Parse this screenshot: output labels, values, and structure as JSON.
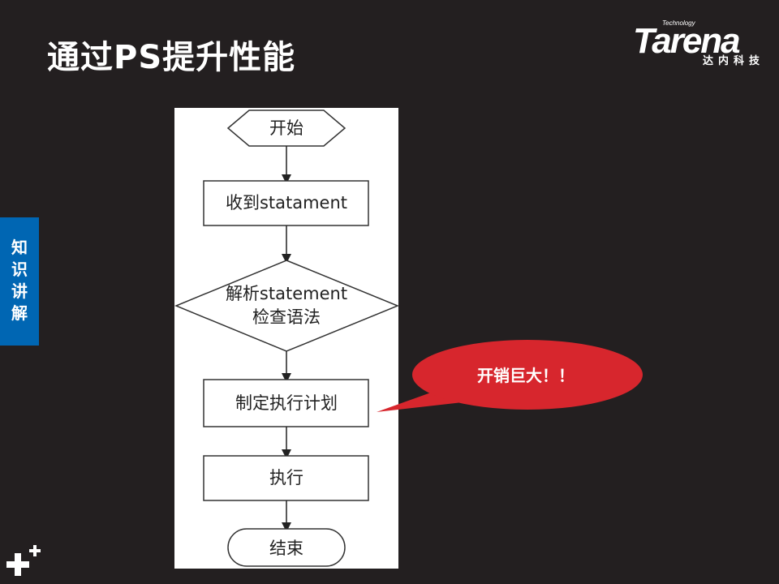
{
  "slide": {
    "title": "通过PS提升性能",
    "side_tab_label": "知识讲解"
  },
  "logo": {
    "small_text": "Technology",
    "brand": "Tarena",
    "cn_text": "达内科技"
  },
  "flowchart": {
    "start": "开始",
    "step1": "收到statament",
    "decision_line1": "解析statement",
    "decision_line2": "检查语法",
    "step3": "制定执行计划",
    "step4": "执行",
    "end": "结束"
  },
  "callout": {
    "text": "开销巨大！！"
  },
  "colors": {
    "background": "#231f20",
    "side_tab": "#0066b3",
    "callout": "#d7262d",
    "panel": "#ffffff"
  },
  "icons": {
    "corner_mark": "plus-plus-icon"
  }
}
